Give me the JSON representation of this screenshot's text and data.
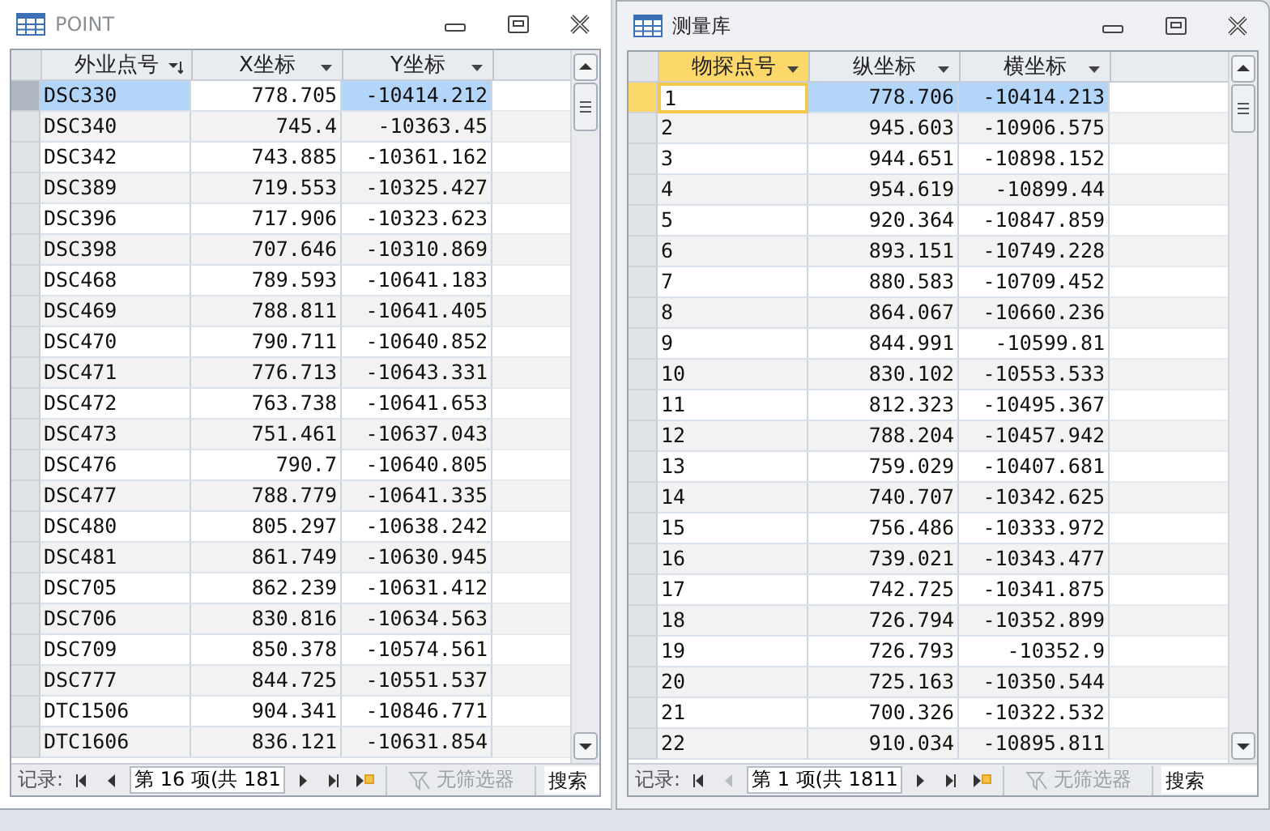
{
  "windows": [
    {
      "title": "POINT",
      "active": false,
      "columns": [
        {
          "label": "外业点号",
          "sorted": true,
          "selected": false,
          "highlighted": true,
          "focused": false
        },
        {
          "label": "X坐标",
          "sorted": false,
          "selected": false,
          "highlighted": false,
          "focused": false
        },
        {
          "label": "Y坐标",
          "sorted": false,
          "selected": false,
          "highlighted": true,
          "focused": false
        }
      ],
      "rows": [
        {
          "selected": true,
          "cells": [
            "DSC330",
            "778.705",
            "-10414.212"
          ]
        },
        {
          "selected": false,
          "cells": [
            "DSC340",
            "745.4",
            "-10363.45"
          ]
        },
        {
          "selected": false,
          "cells": [
            "DSC342",
            "743.885",
            "-10361.162"
          ]
        },
        {
          "selected": false,
          "cells": [
            "DSC389",
            "719.553",
            "-10325.427"
          ]
        },
        {
          "selected": false,
          "cells": [
            "DSC396",
            "717.906",
            "-10323.623"
          ]
        },
        {
          "selected": false,
          "cells": [
            "DSC398",
            "707.646",
            "-10310.869"
          ]
        },
        {
          "selected": false,
          "cells": [
            "DSC468",
            "789.593",
            "-10641.183"
          ]
        },
        {
          "selected": false,
          "cells": [
            "DSC469",
            "788.811",
            "-10641.405"
          ]
        },
        {
          "selected": false,
          "cells": [
            "DSC470",
            "790.711",
            "-10640.852"
          ]
        },
        {
          "selected": false,
          "cells": [
            "DSC471",
            "776.713",
            "-10643.331"
          ]
        },
        {
          "selected": false,
          "cells": [
            "DSC472",
            "763.738",
            "-10641.653"
          ]
        },
        {
          "selected": false,
          "cells": [
            "DSC473",
            "751.461",
            "-10637.043"
          ]
        },
        {
          "selected": false,
          "cells": [
            "DSC476",
            "790.7",
            "-10640.805"
          ]
        },
        {
          "selected": false,
          "cells": [
            "DSC477",
            "788.779",
            "-10641.335"
          ]
        },
        {
          "selected": false,
          "cells": [
            "DSC480",
            "805.297",
            "-10638.242"
          ]
        },
        {
          "selected": false,
          "cells": [
            "DSC481",
            "861.749",
            "-10630.945"
          ]
        },
        {
          "selected": false,
          "cells": [
            "DSC705",
            "862.239",
            "-10631.412"
          ]
        },
        {
          "selected": false,
          "cells": [
            "DSC706",
            "830.816",
            "-10634.563"
          ]
        },
        {
          "selected": false,
          "cells": [
            "DSC709",
            "850.378",
            "-10574.561"
          ]
        },
        {
          "selected": false,
          "cells": [
            "DSC777",
            "844.725",
            "-10551.537"
          ]
        },
        {
          "selected": false,
          "cells": [
            "DTC1506",
            "904.341",
            "-10846.771"
          ]
        },
        {
          "selected": false,
          "cells": [
            "DTC1606",
            "836.121",
            "-10631.854"
          ]
        }
      ],
      "nav": {
        "label": "记录:",
        "position": "第 16 项(共 181",
        "buttons": [
          {
            "kind": "first",
            "disabled": false
          },
          {
            "kind": "prev",
            "disabled": false
          },
          {
            "kind": "next",
            "disabled": false
          },
          {
            "kind": "last",
            "disabled": false
          },
          {
            "kind": "new",
            "disabled": false
          }
        ],
        "filter": {
          "label": "无筛选器",
          "disabled": true
        },
        "search": {
          "placeholder": "搜索"
        }
      }
    },
    {
      "title": "测量库",
      "active": true,
      "columns": [
        {
          "label": "物探点号",
          "sorted": false,
          "selected": true,
          "highlighted": false,
          "focused": true
        },
        {
          "label": "纵坐标",
          "sorted": false,
          "selected": false,
          "highlighted": true,
          "focused": false
        },
        {
          "label": "横坐标",
          "sorted": false,
          "selected": false,
          "highlighted": true,
          "focused": false
        }
      ],
      "rows": [
        {
          "selected": true,
          "cells": [
            "1",
            "778.706",
            "-10414.213"
          ]
        },
        {
          "selected": false,
          "cells": [
            "2",
            "945.603",
            "-10906.575"
          ]
        },
        {
          "selected": false,
          "cells": [
            "3",
            "944.651",
            "-10898.152"
          ]
        },
        {
          "selected": false,
          "cells": [
            "4",
            "954.619",
            "-10899.44"
          ]
        },
        {
          "selected": false,
          "cells": [
            "5",
            "920.364",
            "-10847.859"
          ]
        },
        {
          "selected": false,
          "cells": [
            "6",
            "893.151",
            "-10749.228"
          ]
        },
        {
          "selected": false,
          "cells": [
            "7",
            "880.583",
            "-10709.452"
          ]
        },
        {
          "selected": false,
          "cells": [
            "8",
            "864.067",
            "-10660.236"
          ]
        },
        {
          "selected": false,
          "cells": [
            "9",
            "844.991",
            "-10599.81"
          ]
        },
        {
          "selected": false,
          "cells": [
            "10",
            "830.102",
            "-10553.533"
          ]
        },
        {
          "selected": false,
          "cells": [
            "11",
            "812.323",
            "-10495.367"
          ]
        },
        {
          "selected": false,
          "cells": [
            "12",
            "788.204",
            "-10457.942"
          ]
        },
        {
          "selected": false,
          "cells": [
            "13",
            "759.029",
            "-10407.681"
          ]
        },
        {
          "selected": false,
          "cells": [
            "14",
            "740.707",
            "-10342.625"
          ]
        },
        {
          "selected": false,
          "cells": [
            "15",
            "756.486",
            "-10333.972"
          ]
        },
        {
          "selected": false,
          "cells": [
            "16",
            "739.021",
            "-10343.477"
          ]
        },
        {
          "selected": false,
          "cells": [
            "17",
            "742.725",
            "-10341.875"
          ]
        },
        {
          "selected": false,
          "cells": [
            "18",
            "726.794",
            "-10352.899"
          ]
        },
        {
          "selected": false,
          "cells": [
            "19",
            "726.793",
            "-10352.9"
          ]
        },
        {
          "selected": false,
          "cells": [
            "20",
            "725.163",
            "-10350.544"
          ]
        },
        {
          "selected": false,
          "cells": [
            "21",
            "700.326",
            "-10322.532"
          ]
        },
        {
          "selected": false,
          "cells": [
            "22",
            "910.034",
            "-10895.811"
          ]
        }
      ],
      "nav": {
        "label": "记录:",
        "position": "第 1 项(共 1811",
        "buttons": [
          {
            "kind": "first",
            "disabled": false
          },
          {
            "kind": "prev",
            "disabled": true
          },
          {
            "kind": "next",
            "disabled": false
          },
          {
            "kind": "last",
            "disabled": false
          },
          {
            "kind": "new",
            "disabled": false
          }
        ],
        "filter": {
          "label": "无筛选器",
          "disabled": true
        },
        "search": {
          "placeholder": "搜索"
        }
      }
    }
  ]
}
